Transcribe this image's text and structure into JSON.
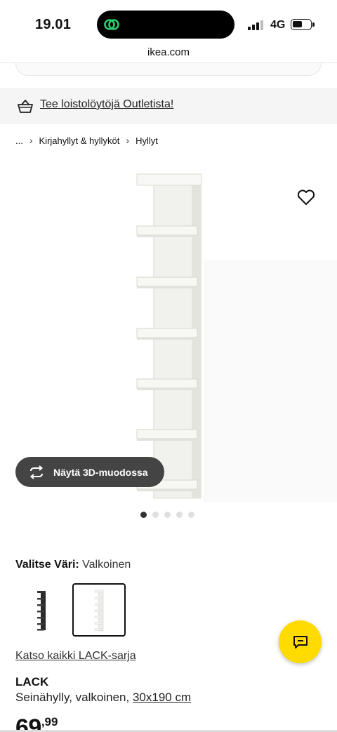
{
  "status_bar": {
    "time": "19.01",
    "network": "4G",
    "battery_level": 0.55
  },
  "browser": {
    "domain": "ikea.com"
  },
  "promo": {
    "icon": "basket-icon",
    "text": "Tee loistolöytöjä Outletista!"
  },
  "breadcrumb": {
    "ellipsis": "...",
    "items": [
      "Kirjahyllyt & hyllyköt",
      "Hyllyt"
    ]
  },
  "gallery": {
    "view_3d_label": "Näytä 3D-muodossa",
    "image_count": 5,
    "active_index": 0
  },
  "color_selector": {
    "label": "Valitse Väri:",
    "selected": "Valkoinen",
    "options": [
      "black",
      "white"
    ]
  },
  "series_link": "Katso kaikki LACK-sarja",
  "product": {
    "name": "LACK",
    "description": "Seinähylly, valkoinen, ",
    "size": "30x190 cm",
    "price_integer": "69",
    "price_decimal": ",99"
  },
  "colors": {
    "accent_yellow": "#ffdb00",
    "button_dark": "#444444",
    "promo_bg": "#f5f5f5"
  }
}
